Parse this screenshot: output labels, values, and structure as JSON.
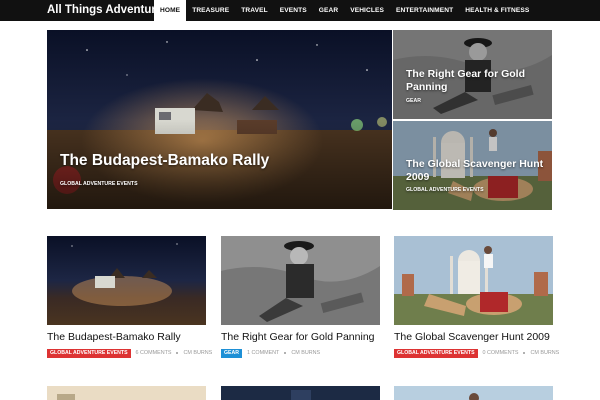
{
  "site": {
    "logo": "All Things Adventure"
  },
  "nav": {
    "items": [
      "HOME",
      "TREASURE",
      "TRAVEL",
      "EVENTS",
      "GEAR",
      "VEHICLES",
      "ENTERTAINMENT",
      "HEALTH & FITNESS"
    ],
    "active": "HOME"
  },
  "hero": {
    "main": {
      "title": "The Budapest-Bamako Rally",
      "category": "GLOBAL ADVENTURE EVENTS"
    },
    "side": [
      {
        "title": "The Right Gear for Gold Panning",
        "category": "GEAR"
      },
      {
        "title": "The Global Scavenger Hunt 2009",
        "category": "GLOBAL ADVENTURE EVENTS"
      }
    ]
  },
  "cards": [
    {
      "title": "The Budapest-Bamako Rally",
      "category": "GLOBAL ADVENTURE EVENTS",
      "category_color": "#dd3333",
      "comments": "6 COMMENTS",
      "author": "CM BURNS"
    },
    {
      "title": "The Right Gear for Gold Panning",
      "category": "GEAR",
      "category_color": "#1e90d6",
      "comments": "1 COMMENT",
      "author": "CM BURNS"
    },
    {
      "title": "The Global Scavenger Hunt 2009",
      "category": "GLOBAL ADVENTURE EVENTS",
      "category_color": "#dd3333",
      "comments": "0 COMMENTS",
      "author": "CM BURNS"
    }
  ]
}
